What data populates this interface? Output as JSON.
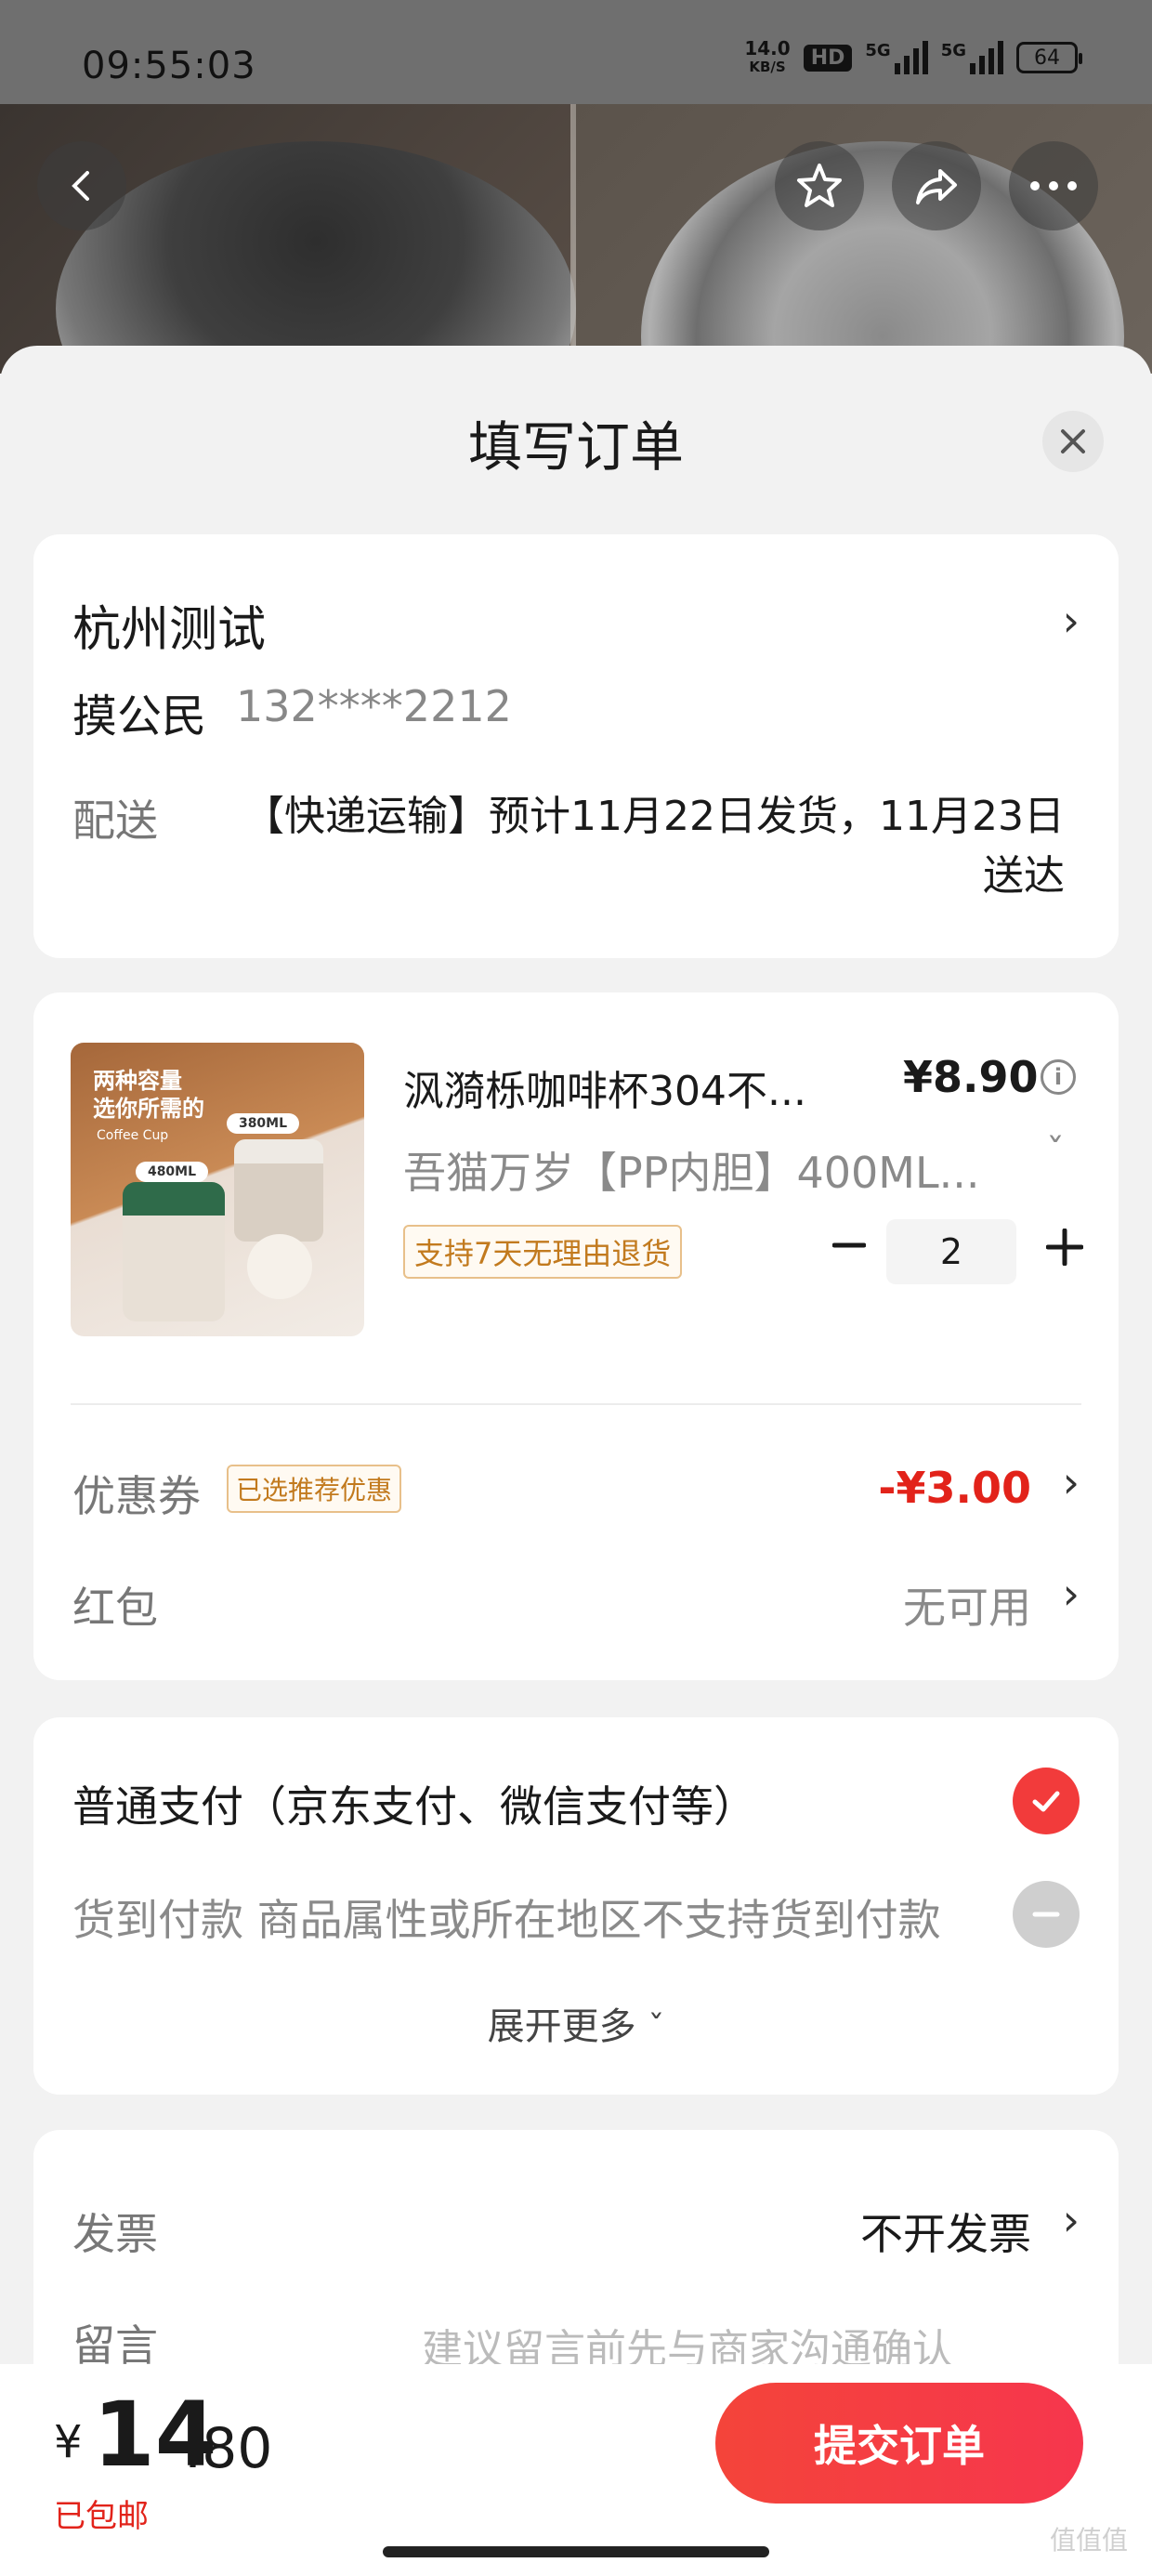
{
  "status_bar": {
    "time": "09:55:03",
    "net_speed_value": "14.0",
    "net_speed_unit": "KB/S",
    "hd_label": "HD",
    "signal1_label": "5G",
    "signal2_label": "5G",
    "battery": "64"
  },
  "header": {
    "title": "填写订单",
    "close_icon": "close-icon"
  },
  "address": {
    "title": "杭州测试",
    "name": "摸公民",
    "phone": "132****2212",
    "shipping_label": "配送",
    "shipping_text": "【快递运输】预计11月22日发货，11月23日送达"
  },
  "product": {
    "title": "沨漪栎咖啡杯304不...",
    "price": "¥8.90",
    "spec": "吾猫万岁【PP内胆】400ML...",
    "return_badge": "支持7天无理由退货",
    "quantity": "2",
    "image_text1": "两种容量",
    "image_text2": "选你所需的",
    "image_tag1": "380ML",
    "image_tag2": "480ML",
    "image_brand": "Coffee Cup"
  },
  "coupon": {
    "label": "优惠券",
    "badge": "已选推荐优惠",
    "value": "-¥3.00"
  },
  "red_packet": {
    "label": "红包",
    "value": "无可用"
  },
  "payment": {
    "option1": "普通支付（京东支付、微信支付等）",
    "option2": "货到付款 商品属性或所在地区不支持货到付款",
    "expand": "展开更多"
  },
  "invoice": {
    "label": "发票",
    "value": "不开发票"
  },
  "message": {
    "label": "留言",
    "placeholder": "建议留言前先与商家沟通确认"
  },
  "bottom": {
    "currency": "¥",
    "price_int": "14",
    "price_dec": ".80",
    "shipping": "已包邮",
    "submit": "提交订单"
  },
  "watermark": "值值值",
  "colors": {
    "accent": "#e2231a",
    "button": "#f4443a",
    "badge_border": "#e8c08a"
  }
}
